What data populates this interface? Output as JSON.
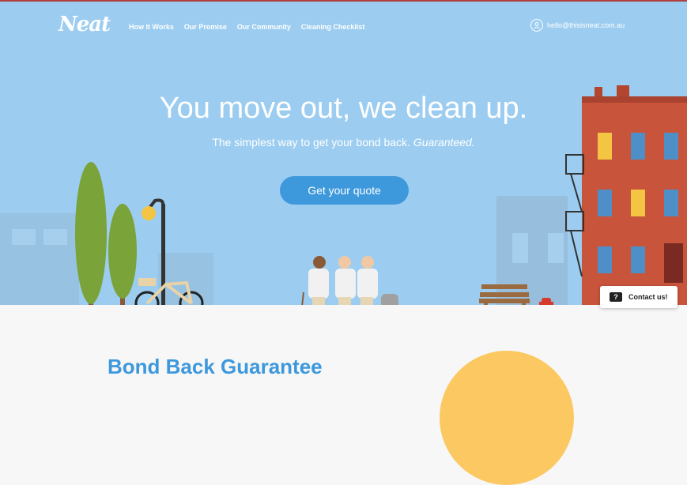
{
  "brand": {
    "logo": "Neat"
  },
  "nav": {
    "links": [
      "How It Works",
      "Our Promise",
      "Our Community",
      "Cleaning Checklist"
    ],
    "email": "hello@thisisneat.com.au"
  },
  "hero": {
    "headline": "You move out, we clean up.",
    "subtitle": "The simplest way to get your bond back.",
    "subtitle_emphasis": "Guaranteed.",
    "cta": "Get your quote"
  },
  "section": {
    "title": "Bond Back Guarantee"
  },
  "contact": {
    "label": "Contact us!",
    "icon": "?"
  },
  "colors": {
    "sky": "#9ccdf0",
    "accent": "#3d98dc",
    "sun": "#fbc862",
    "brick": "#c8543c"
  }
}
